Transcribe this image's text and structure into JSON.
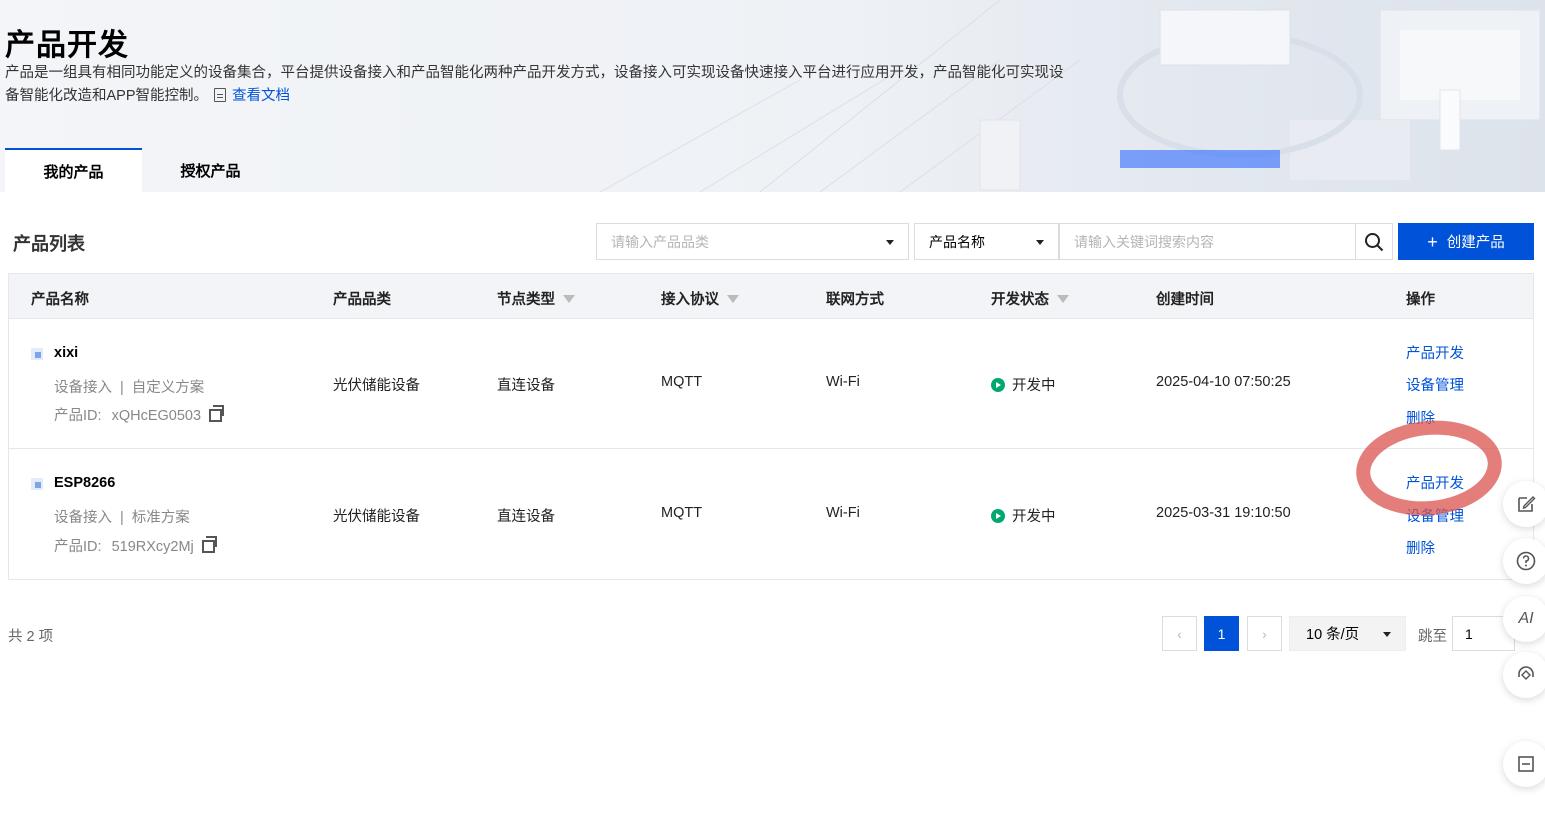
{
  "header": {
    "title": "产品开发",
    "description": "产品是一组具有相同功能定义的设备集合，平台提供设备接入和产品智能化两种产品开发方式，设备接入可实现设备快速接入平台进行应用开发，产品智能化可实现设备智能化改造和APP智能控制。",
    "doc_link": "查看文档"
  },
  "tabs": [
    {
      "label": "我的产品",
      "active": true
    },
    {
      "label": "授权产品",
      "active": false
    }
  ],
  "toolbar": {
    "list_title": "产品列表",
    "category_placeholder": "请输入产品品类",
    "field_select": "产品名称",
    "keyword_placeholder": "请输入关键词搜索内容",
    "create_label": "创建产品",
    "accent_color": "#0052d9"
  },
  "table": {
    "columns": [
      "产品名称",
      "产品品类",
      "节点类型",
      "接入协议",
      "联网方式",
      "开发状态",
      "创建时间",
      "操作"
    ],
    "rows": [
      {
        "name": "xixi",
        "access": "设备接入",
        "sep": "|",
        "scheme": "自定义方案",
        "id_label": "产品ID:",
        "id": "xQHcEG0503",
        "category": "光伏储能设备",
        "node_type": "直连设备",
        "protocol": "MQTT",
        "network": "Wi-Fi",
        "status": "开发中",
        "created": "2025-04-10 07:50:25",
        "ops": [
          "产品开发",
          "设备管理",
          "删除"
        ]
      },
      {
        "name": "ESP8266",
        "access": "设备接入",
        "sep": "|",
        "scheme": "标准方案",
        "id_label": "产品ID:",
        "id": "519RXcy2Mj",
        "category": "光伏储能设备",
        "node_type": "直连设备",
        "protocol": "MQTT",
        "network": "Wi-Fi",
        "status": "开发中",
        "created": "2025-03-31 19:10:50",
        "ops": [
          "产品开发",
          "设备管理",
          "删除"
        ]
      }
    ]
  },
  "pagination": {
    "total": "共 2 项",
    "current_page": "1",
    "page_size": "10 条/页",
    "jump_label": "跳至",
    "jump_value": "1"
  },
  "floating": {
    "ai_label": "AI"
  }
}
